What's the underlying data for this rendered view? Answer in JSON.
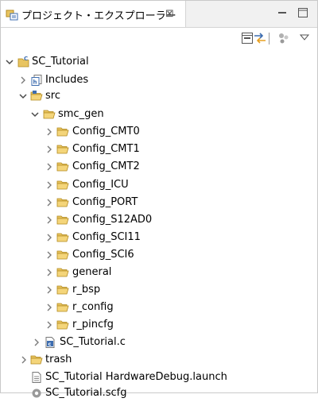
{
  "view": {
    "tab_title": "プロジェクト・エクスプローラー",
    "tab_close": "⊠"
  },
  "tree": {
    "project": "SC_Tutorial",
    "includes": "Includes",
    "src": "src",
    "smc_gen": "smc_gen",
    "smc_gen_children": [
      "Config_CMT0",
      "Config_CMT1",
      "Config_CMT2",
      "Config_ICU",
      "Config_PORT",
      "Config_S12AD0",
      "Config_SCI11",
      "Config_SCI6",
      "general",
      "r_bsp",
      "r_config",
      "r_pincfg"
    ],
    "main_file": "SC_Tutorial.c",
    "trash": "trash",
    "launch_file": "SC_Tutorial HardwareDebug.launch",
    "scfg_file": "SC_Tutorial.scfg"
  },
  "colors": {
    "folder": "#e8c460",
    "folder_dark": "#b38a1f",
    "file_blue": "#3d6db0"
  }
}
